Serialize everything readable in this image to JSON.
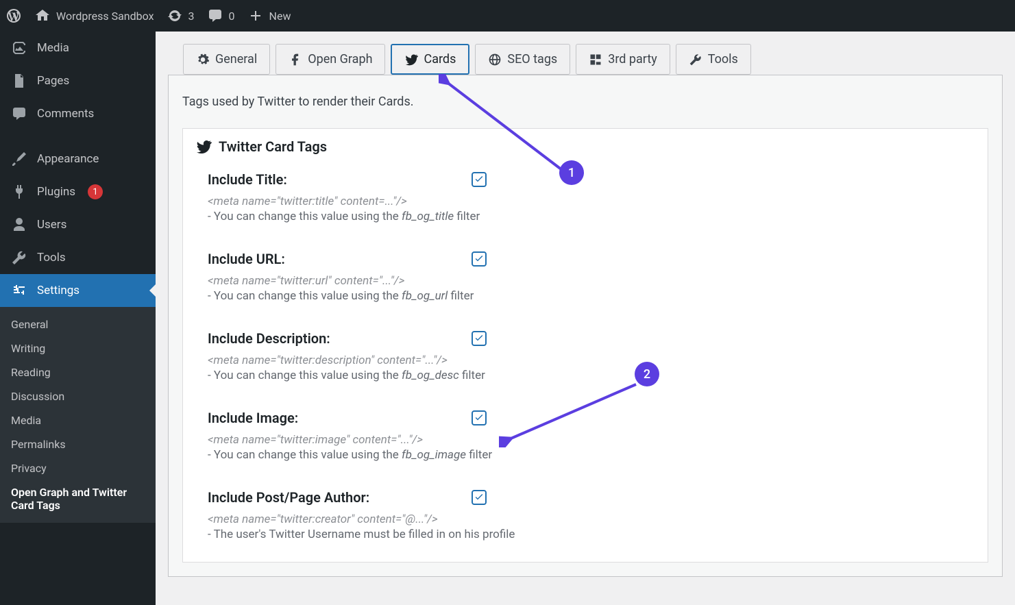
{
  "adminbar": {
    "site": "Wordpress Sandbox",
    "updates": "3",
    "comments": "0",
    "new": "New"
  },
  "sidebar": {
    "items": [
      {
        "label": "Media"
      },
      {
        "label": "Pages"
      },
      {
        "label": "Comments"
      },
      {
        "label": "Appearance"
      },
      {
        "label": "Plugins",
        "badge": "1"
      },
      {
        "label": "Users"
      },
      {
        "label": "Tools"
      },
      {
        "label": "Settings"
      }
    ],
    "sub": {
      "general": "General",
      "writing": "Writing",
      "reading": "Reading",
      "discussion": "Discussion",
      "media": "Media",
      "permalinks": "Permalinks",
      "privacy": "Privacy",
      "ogtw": "Open Graph and Twitter Card Tags"
    }
  },
  "tabs": {
    "general": "General",
    "opengraph": "Open Graph",
    "cards": "Cards",
    "seo": "SEO tags",
    "thirdparty": "3rd party",
    "tools": "Tools"
  },
  "panel": {
    "desc": "Tags used by Twitter to render their Cards.",
    "cardTitle": "Twitter Card Tags"
  },
  "fields": {
    "title": {
      "label": "Include Title:",
      "meta": "<meta name=\"twitter:title\" content=...\"/>",
      "note_pre": "- You can change this value using the ",
      "note_filter": "fb_og_title",
      "note_post": " filter"
    },
    "url": {
      "label": "Include URL:",
      "meta": "<meta name=\"twitter:url\" content=\"...\"/>",
      "note_pre": "- You can change this value using the ",
      "note_filter": "fb_og_url",
      "note_post": " filter"
    },
    "desc": {
      "label": "Include Description:",
      "meta": "<meta name=\"twitter:description\" content=\"...\"/>",
      "note_pre": "- You can change this value using the ",
      "note_filter": "fb_og_desc",
      "note_post": " filter"
    },
    "image": {
      "label": "Include Image:",
      "meta": "<meta name=\"twitter:image\" content=\"...\"/>",
      "note_pre": "- You can change this value using the ",
      "note_filter": "fb_og_image",
      "note_post": " filter"
    },
    "author": {
      "label": "Include Post/Page Author:",
      "meta": "<meta name=\"twitter:creator\" content=\"@...\"/>",
      "note": "- The user's Twitter Username must be filled in on his profile"
    }
  },
  "annotations": {
    "one": "1",
    "two": "2"
  }
}
